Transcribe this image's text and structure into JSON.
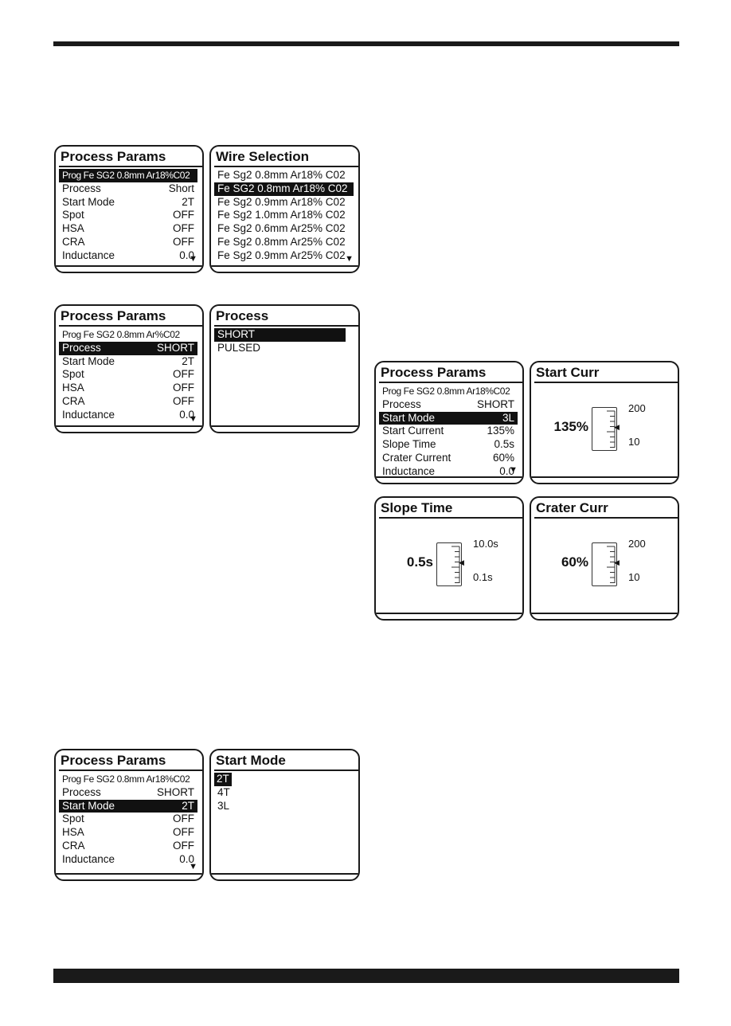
{
  "panels": [
    {
      "title": "Process Params",
      "type": "params",
      "rows": [
        [
          "Prog Fe SG2 0.8mm Ar18%C02",
          ""
        ],
        [
          "Process",
          "Short"
        ],
        [
          "Start Mode",
          "2T"
        ],
        [
          "Spot",
          "OFF"
        ],
        [
          "HSA",
          "OFF"
        ],
        [
          "CRA",
          "OFF"
        ],
        [
          "Inductance",
          "0.0"
        ]
      ],
      "selected": 0,
      "scroll_icon": "scroll-down-arrow"
    },
    {
      "title": "Wire Selection",
      "type": "list",
      "items": [
        "Fe Sg2 0.8mm Ar18% C02",
        "Fe SG2 0.8mm  Ar18%  C02",
        "Fe Sg2 0.9mm Ar18% C02",
        "Fe Sg2 1.0mm Ar18% C02",
        "Fe Sg2 0.6mm Ar25% C02",
        "Fe Sg2 0.8mm Ar25% C02",
        "Fe Sg2 0.9mm Ar25% C02"
      ],
      "selected": 1,
      "scroll_icon": "scroll-down-arrow"
    },
    {
      "title": "Process Params",
      "type": "params",
      "rows": [
        [
          "Prog Fe SG2 0.8mm Ar%C02",
          ""
        ],
        [
          "Process",
          "SHORT"
        ],
        [
          "Start Mode",
          "2T"
        ],
        [
          "Spot",
          "OFF"
        ],
        [
          "HSA",
          "OFF"
        ],
        [
          "CRA",
          "OFF"
        ],
        [
          "Inductance",
          "0.0"
        ]
      ],
      "selected": 1,
      "scroll_icon": "scroll-down-arrow"
    },
    {
      "title": "Process",
      "type": "list",
      "items": [
        "SHORT",
        "PULSED"
      ],
      "selected": 0
    },
    {
      "title": "Process Params",
      "type": "params",
      "rows": [
        [
          "Prog Fe SG2 0.8mm Ar18%C02",
          ""
        ],
        [
          "Process",
          "SHORT"
        ],
        [
          "Start Mode",
          "3L"
        ],
        [
          "Start Current",
          "135%"
        ],
        [
          "Slope Time",
          "0.5s"
        ],
        [
          "Crater Current",
          "60%"
        ],
        [
          "Inductance",
          "0.0"
        ]
      ],
      "selected": 2,
      "scroll_icon": "scroll-down-arrow"
    },
    {
      "title": "Start Curr",
      "type": "gauge",
      "value": "135%",
      "max": "200",
      "min": "10"
    },
    {
      "title": "Slope Time",
      "type": "gauge",
      "value": "0.5s",
      "max": "10.0s",
      "min": "0.1s"
    },
    {
      "title": "Crater Curr",
      "type": "gauge",
      "value": "60%",
      "max": "200",
      "min": "10"
    },
    {
      "title": "Process Params",
      "type": "params",
      "rows": [
        [
          "Prog Fe SG2 0.8mm Ar18%C02",
          ""
        ],
        [
          "Process",
          "SHORT"
        ],
        [
          "Start Mode",
          "2T"
        ],
        [
          "Spot",
          "OFF"
        ],
        [
          "HSA",
          "OFF"
        ],
        [
          "CRA",
          "OFF"
        ],
        [
          "Inductance",
          "0.0"
        ]
      ],
      "selected": 2,
      "scroll_icon": "scroll-down-arrow"
    },
    {
      "title": "Start Mode",
      "type": "list",
      "items": [
        "2T",
        "4T",
        "3L"
      ],
      "selected": 0,
      "narrow_select": true
    }
  ]
}
